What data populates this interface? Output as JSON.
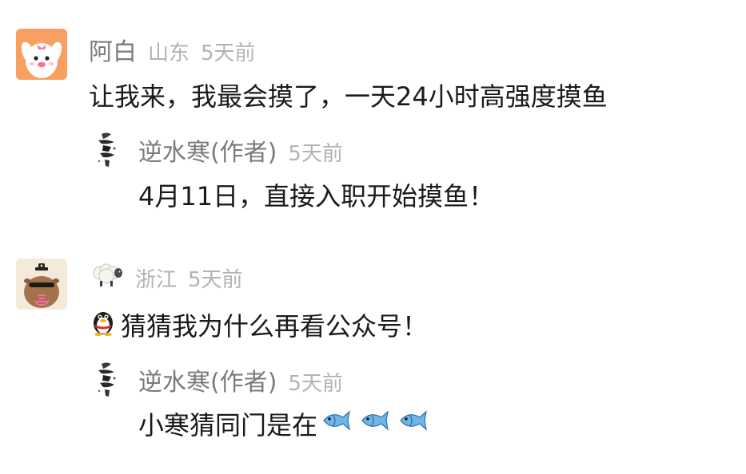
{
  "comments": [
    {
      "author": "阿白",
      "location": "山东",
      "time": "5天前",
      "avatar_icon": "bunny-avatar",
      "text": "让我来，我最会摸了，一天24小时高强度摸鱼",
      "reply": {
        "author": "逆水寒(作者)",
        "time": "5天前",
        "avatar_icon": "calligraphy-avatar",
        "text": "4月11日，直接入职开始摸鱼！"
      }
    },
    {
      "author_icon": "sheep-emoji",
      "location": "浙江",
      "time": "5天前",
      "avatar_icon": "capybara-avatar",
      "text_prefix_icon": "qq-penguin-icon",
      "text": "猜猜我为什么再看公众号！",
      "reply": {
        "author": "逆水寒(作者)",
        "time": "5天前",
        "avatar_icon": "calligraphy-avatar",
        "text": "小寒猜同门是在",
        "trailing_icons": [
          "fish-emoji",
          "fish-emoji",
          "fish-emoji"
        ]
      }
    }
  ],
  "colors": {
    "name": "#7b7b7b",
    "meta": "#b3b3b3",
    "text": "#1a1a1a",
    "avatar_orange": "#f7a062",
    "avatar_capy_bg": "#f3ead9"
  }
}
